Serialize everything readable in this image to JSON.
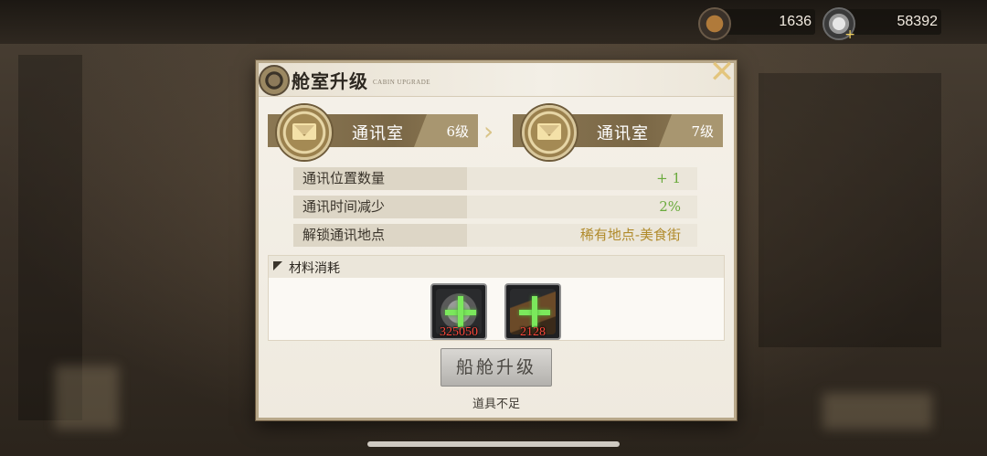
{
  "currency": [
    {
      "icon": "book-currency-icon",
      "value": "1636"
    },
    {
      "icon": "silver-coin-add-icon",
      "value": "58392"
    }
  ],
  "dialog": {
    "title": "舱室升级",
    "subtitle": "CABIN UPGRADE",
    "close_icon": "close-x-icon",
    "current": {
      "name": "通讯室",
      "level": "6级",
      "icon": "envelope-medal-icon"
    },
    "next": {
      "name": "通讯室",
      "level": "7级",
      "icon": "envelope-medal-icon"
    },
    "arrow": "›",
    "stats": [
      {
        "label": "通讯位置数量",
        "value": "+ 1",
        "color": "#6aaa3c"
      },
      {
        "label": "通讯时间减少",
        "value": "2%",
        "color": "#6aaa3c"
      },
      {
        "label": "解锁通讯地点",
        "value": "稀有地点-美食街",
        "color": "#b08a2a"
      }
    ],
    "materials": {
      "title": "材料消耗",
      "items": [
        {
          "icon": "silver-coin-material-icon",
          "count": "325050"
        },
        {
          "icon": "book-material-icon",
          "count": "2128"
        }
      ]
    },
    "upgrade_button": "船舱升级",
    "note": "道具不足"
  }
}
